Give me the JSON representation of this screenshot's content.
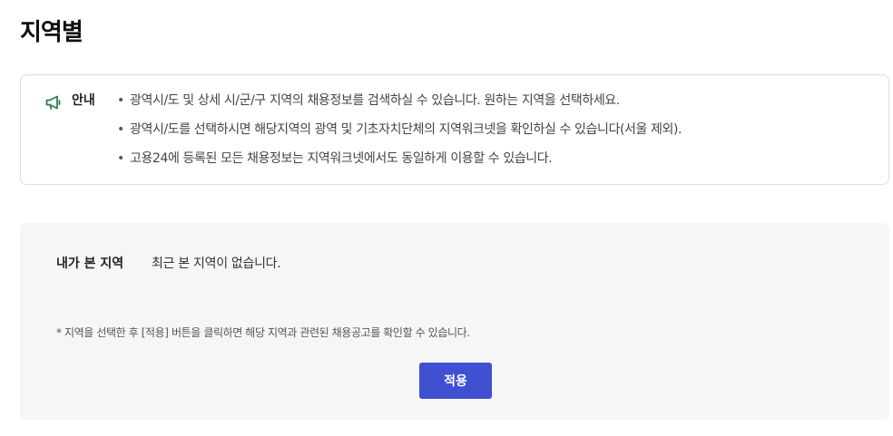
{
  "page": {
    "title": "지역별"
  },
  "notice": {
    "icon": "megaphone-icon",
    "icon_color": "#2e7d4f",
    "label": "안내",
    "bullet": "•",
    "items": [
      "광역시/도 및 상세 시/군/구 지역의 채용정보를 검색하실 수 있습니다. 원하는 지역을 선택하세요.",
      "광역시/도를 선택하시면 해당지역의 광역 및 기초자치단체의 지역워크넷을 확인하실 수 있습니다(서울 제외).",
      "고용24에 등록된 모든 채용정보는 지역워크넷에서도 동일하게 이용할 수 있습니다."
    ]
  },
  "recent": {
    "label": "내가 본 지역",
    "empty_message": "최근 본 지역이 없습니다.",
    "note": "* 지역을 선택한 후 [적용] 버튼을 클릭하면 해당 지역과 관련된 채용공고를 확인할 수 있습니다.",
    "apply_label": "적용",
    "apply_color": "#3f51d1"
  }
}
